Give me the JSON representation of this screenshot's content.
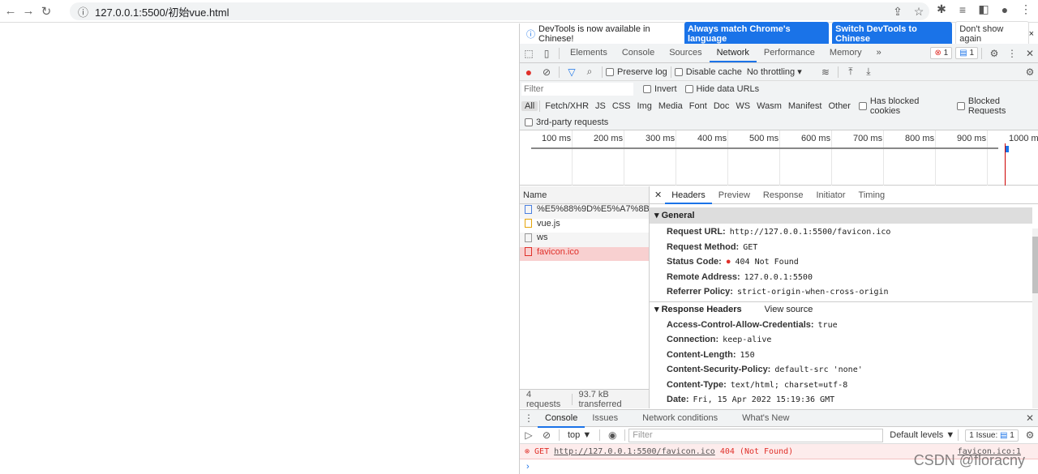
{
  "browser": {
    "url": "127.0.0.1:5500/初始vue.html",
    "icons": [
      "back-icon",
      "forward-icon",
      "reload-icon",
      "info-icon",
      "share-icon",
      "star-icon",
      "extensions-icon",
      "reading-list-icon",
      "sidebar-icon",
      "profile-icon",
      "menu-icon"
    ]
  },
  "infobar": {
    "message": "DevTools is now available in Chinese!",
    "btn_match": "Always match Chrome's language",
    "btn_switch": "Switch DevTools to Chinese",
    "btn_dismiss": "Don't show again"
  },
  "tabs": {
    "items": [
      "Elements",
      "Console",
      "Sources",
      "Network",
      "Performance",
      "Memory"
    ],
    "active": "Network",
    "more": "»",
    "errors": "1",
    "messages": "1"
  },
  "toolbar": {
    "preserve_log": "Preserve log",
    "disable_cache": "Disable cache",
    "throttling": "No throttling"
  },
  "filter": {
    "placeholder": "Filter",
    "invert": "Invert",
    "hide_data_urls": "Hide data URLs"
  },
  "types": {
    "items": [
      "All",
      "Fetch/XHR",
      "JS",
      "CSS",
      "Img",
      "Media",
      "Font",
      "Doc",
      "WS",
      "Wasm",
      "Manifest",
      "Other"
    ],
    "blocked_cookies": "Has blocked cookies",
    "blocked_requests": "Blocked Requests",
    "third_party": "3rd-party requests"
  },
  "timeline": {
    "ticks": [
      "100 ms",
      "200 ms",
      "300 ms",
      "400 ms",
      "500 ms",
      "600 ms",
      "700 ms",
      "800 ms",
      "900 ms",
      "1000 ms"
    ]
  },
  "requests": {
    "header": "Name",
    "rows": [
      {
        "name": "%E5%88%9D%E5%A7%8Bv...",
        "type": "doc"
      },
      {
        "name": "vue.js",
        "type": "script"
      },
      {
        "name": "ws",
        "type": "other"
      },
      {
        "name": "favicon.ico",
        "type": "error"
      }
    ],
    "count": "4 requests",
    "transferred": "93.7 kB transferred"
  },
  "details": {
    "tabs": [
      "Headers",
      "Preview",
      "Response",
      "Initiator",
      "Timing"
    ],
    "active": "Headers",
    "general_title": "General",
    "general": [
      {
        "k": "Request URL:",
        "v": "http://127.0.0.1:5500/favicon.ico"
      },
      {
        "k": "Request Method:",
        "v": "GET"
      },
      {
        "k": "Status Code:",
        "v": "404 Not Found"
      },
      {
        "k": "Remote Address:",
        "v": "127.0.0.1:5500"
      },
      {
        "k": "Referrer Policy:",
        "v": "strict-origin-when-cross-origin"
      }
    ],
    "response_title": "Response Headers",
    "view_source": "View source",
    "response": [
      {
        "k": "Access-Control-Allow-Credentials:",
        "v": "true"
      },
      {
        "k": "Connection:",
        "v": "keep-alive"
      },
      {
        "k": "Content-Length:",
        "v": "150"
      },
      {
        "k": "Content-Security-Policy:",
        "v": "default-src 'none'"
      },
      {
        "k": "Content-Type:",
        "v": "text/html; charset=utf-8"
      },
      {
        "k": "Date:",
        "v": "Fri, 15 Apr 2022 15:19:36 GMT"
      }
    ]
  },
  "drawer": {
    "tabs": [
      "Console",
      "Issues",
      "Network conditions",
      "What's New"
    ],
    "active": "Console",
    "context": "top ▼",
    "filter_placeholder": "Filter",
    "levels": "Default levels ▼",
    "issues": "1 Issue:",
    "issues_count": "1",
    "error": {
      "method": "GET",
      "url": "http://127.0.0.1:5500/favicon.ico",
      "status": "404 (Not Found)",
      "source": "favicon.ico:1"
    },
    "prompt": "›"
  },
  "watermark": "CSDN @floracny",
  "colors": {
    "accent": "#1a73e8",
    "error": "#e0302a"
  }
}
